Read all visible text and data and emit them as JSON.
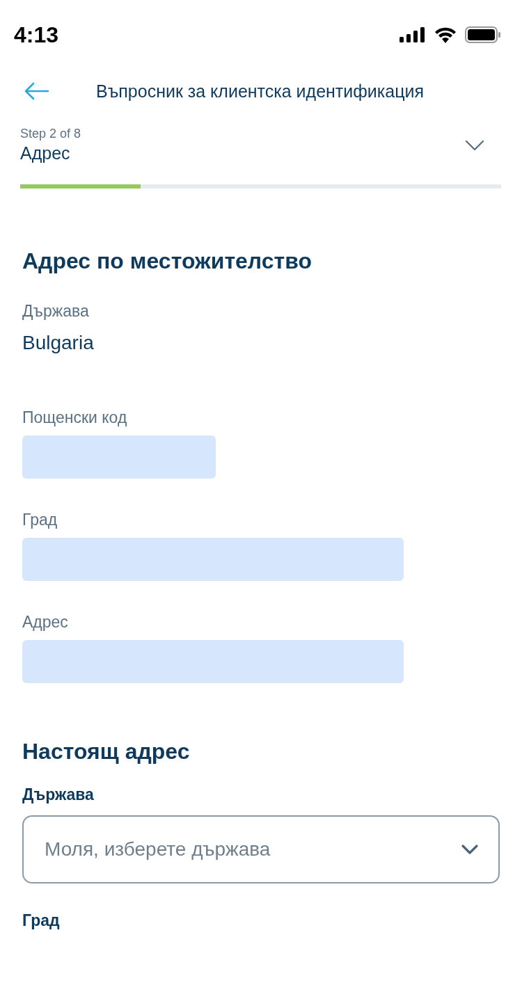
{
  "status_bar": {
    "time": "4:13"
  },
  "header": {
    "title": "Въпросник за клиентска идентификация"
  },
  "stepper": {
    "step": "Step 2 of 8",
    "name": "Адрес",
    "progress": {
      "level": 0.25
    }
  },
  "permanent_address": {
    "heading": "Адрес по местожителство",
    "country": {
      "label": "Държава",
      "value": "Bulgaria"
    },
    "fields": [
      {
        "label": "Пощенски код",
        "kind": "short"
      },
      {
        "label": "Град",
        "kind": "wide"
      },
      {
        "label": "Адрес",
        "kind": "wide"
      }
    ]
  },
  "current_address": {
    "heading": "Настоящ адрес",
    "country": {
      "label": "Държава",
      "placeholder": "Моля, изберете държава"
    },
    "next_label": "Град"
  }
}
